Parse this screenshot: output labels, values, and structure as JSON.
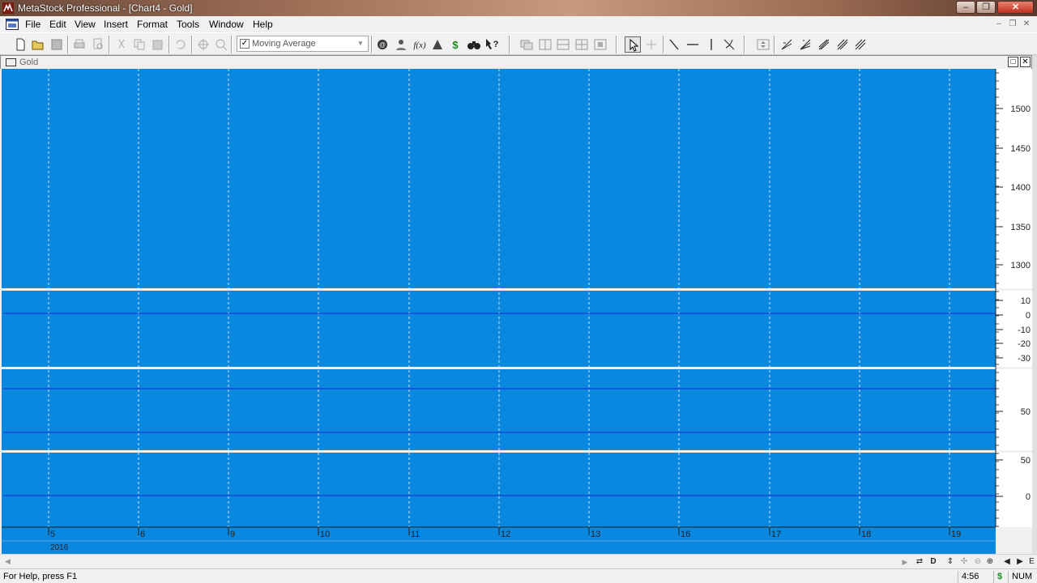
{
  "window": {
    "title": "MetaStock Professional - [Chart4 - Gold]"
  },
  "menu": [
    "File",
    "Edit",
    "View",
    "Insert",
    "Format",
    "Tools",
    "Window",
    "Help"
  ],
  "toolbar": {
    "indicator_select": {
      "value": "Moving Average",
      "options": [
        "Moving Average"
      ]
    }
  },
  "chart_window": {
    "title": "Gold"
  },
  "chart": {
    "background_color": "#0a87de",
    "price_axis_labels": [
      "1500",
      "1450",
      "1400",
      "1350",
      "1300"
    ],
    "panel2_axis_labels": [
      "10",
      "0",
      "-10",
      "-20",
      "-30"
    ],
    "panel3_axis_labels": [
      "50"
    ],
    "panel4_axis_labels": [
      "50",
      "0"
    ],
    "x_axis_labels": [
      "5",
      "6",
      "9",
      "10",
      "11",
      "12",
      "13",
      "16",
      "17",
      "18",
      "19"
    ],
    "year_label": "2016"
  },
  "status": {
    "help_text": "For Help, press F1",
    "time": "4:56",
    "mode": "NUM"
  }
}
